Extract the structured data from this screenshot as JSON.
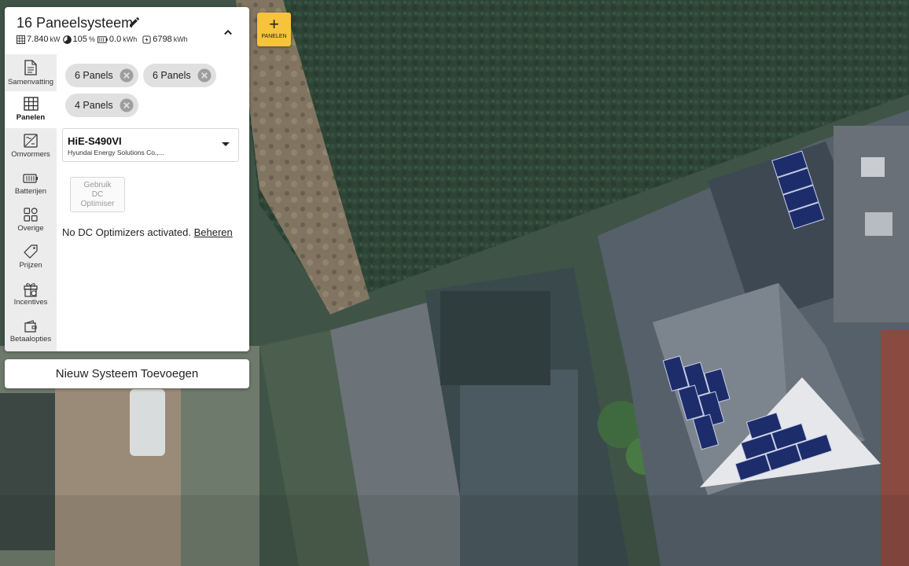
{
  "system": {
    "title": "16 Paneelsysteem",
    "stats": {
      "power": "7.840",
      "power_unit": "kW",
      "ratio": "105",
      "ratio_unit": "%",
      "battery": "0.0",
      "battery_unit": "kWh",
      "production": "6798",
      "production_unit": "kWh"
    }
  },
  "nav": [
    {
      "label": "Samenvatting",
      "icon": "document-icon"
    },
    {
      "label": "Panelen",
      "icon": "solar-panel-icon",
      "active": true
    },
    {
      "label": "Omvormers",
      "icon": "inverter-icon"
    },
    {
      "label": "Batterijen",
      "icon": "battery-icon"
    },
    {
      "label": "Overige",
      "icon": "grid-apps-icon"
    },
    {
      "label": "Prijzen",
      "icon": "price-tag-icon"
    },
    {
      "label": "Incentives",
      "icon": "gift-icon"
    },
    {
      "label": "Betaalopties",
      "icon": "wallet-icon"
    }
  ],
  "chips": [
    {
      "label": "6 Panels"
    },
    {
      "label": "6 Panels"
    },
    {
      "label": "4 Panels"
    }
  ],
  "panel_model": {
    "name": "HiE-S490VI",
    "vendor": "Hyundai Energy Solutions Co.,..."
  },
  "optimizer": {
    "button_line1": "Gebruik",
    "button_line2": "DC",
    "button_line3": "Optimiser",
    "note": "No DC Optimizers activated.",
    "link": "Beheren"
  },
  "new_system_label": "Nieuw Systeem Toevoegen",
  "add_panels": {
    "plus": "+",
    "label": "PANELEN"
  },
  "colors": {
    "accent": "#f6c33b",
    "panel_blue": "#1d2c6b",
    "nav_bg": "#ececec"
  }
}
